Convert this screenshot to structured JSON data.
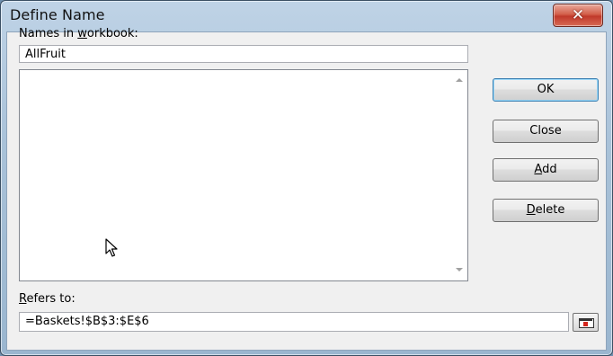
{
  "window": {
    "title": "Define Name",
    "close_glyph": "✕"
  },
  "names": {
    "label_prefix": "Names in ",
    "label_mnemonic": "w",
    "label_suffix": "orkbook:",
    "input_value": "AllFruit",
    "list_items": []
  },
  "buttons": {
    "ok": "OK",
    "close": "Close",
    "add_mnemonic": "A",
    "add_rest": "dd",
    "delete_mnemonic": "D",
    "delete_rest": "elete"
  },
  "refers": {
    "label_mnemonic": "R",
    "label_rest": "efers to:",
    "value": "=Baskets!$B$3:$E$6"
  },
  "icons": {
    "close": "close-icon",
    "scroll_up": "scroll-up-arrow-icon",
    "scroll_down": "scroll-down-arrow-icon",
    "collapse": "collapse-dialog-icon",
    "cursor": "mouse-pointer-icon"
  }
}
